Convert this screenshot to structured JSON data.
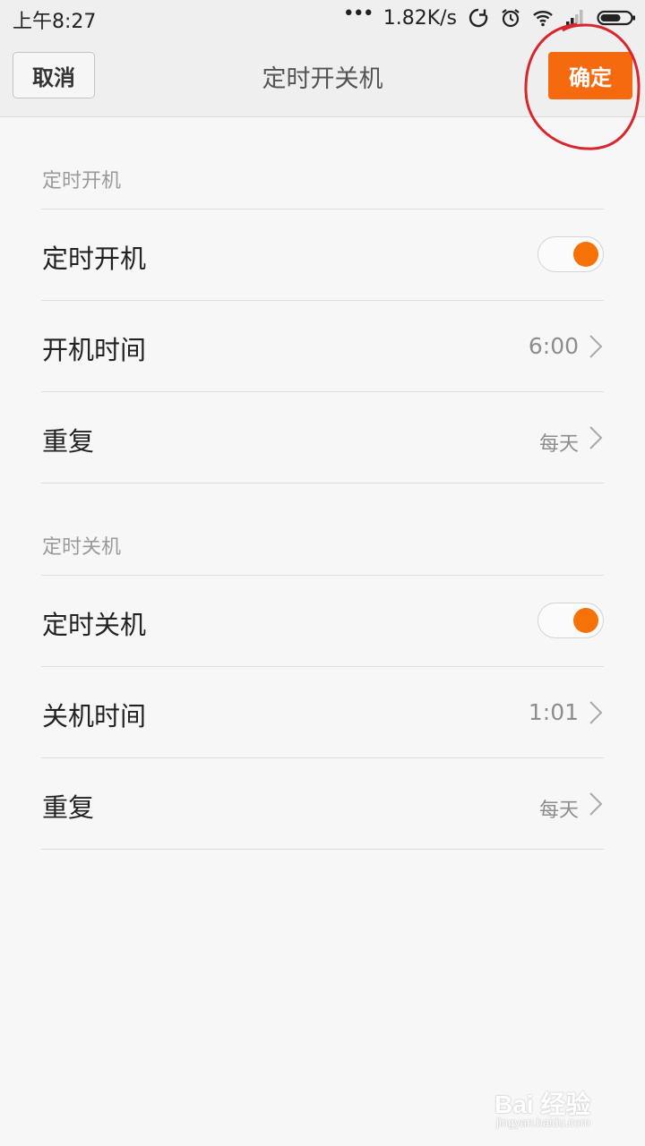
{
  "status_bar": {
    "time": "上午8:27",
    "dots": "•••",
    "net_speed": "1.82K/s",
    "icons": [
      "sync-icon",
      "alarm-icon",
      "wifi-icon",
      "signal-icon",
      "battery-icon"
    ]
  },
  "title_bar": {
    "cancel_label": "取消",
    "title": "定时开关机",
    "confirm_label": "确定",
    "confirm_color": "#f56a0f"
  },
  "power_on": {
    "section_title": "定时开机",
    "toggle_label": "定时开机",
    "toggle_on": true,
    "time_label": "开机时间",
    "time_value": "6:00",
    "repeat_label": "重复",
    "repeat_value": "每天"
  },
  "power_off": {
    "section_title": "定时关机",
    "toggle_label": "定时关机",
    "toggle_on": true,
    "time_label": "关机时间",
    "time_value": "1:01",
    "repeat_label": "重复",
    "repeat_value": "每天"
  },
  "watermark": {
    "brand": "Bai 经验",
    "url": "jingyan.baidu.com"
  },
  "colors": {
    "accent": "#f56a0f",
    "annotation": "#d9262c"
  }
}
